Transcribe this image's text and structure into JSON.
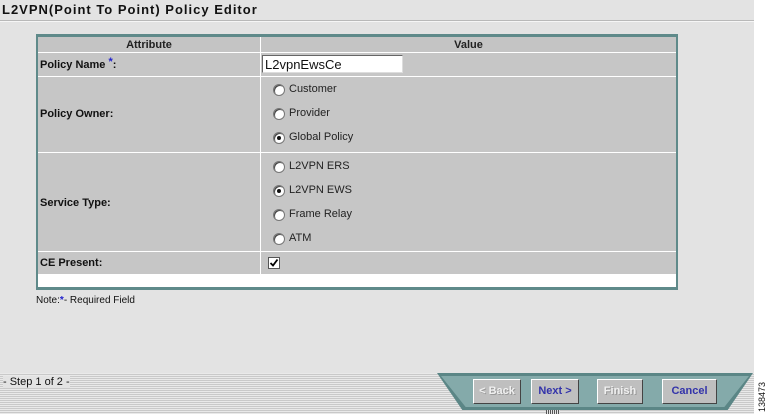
{
  "page": {
    "title": "L2VPN(Point To Point) Policy Editor"
  },
  "table": {
    "header": {
      "attribute": "Attribute",
      "value": "Value"
    },
    "policy_name": {
      "label": "Policy Name",
      "required_mark": "*",
      "colon": ":",
      "value": "L2vpnEwsCe"
    },
    "policy_owner": {
      "label": "Policy Owner:",
      "options": [
        {
          "label": "Customer",
          "selected": false
        },
        {
          "label": "Provider",
          "selected": false
        },
        {
          "label": "Global Policy",
          "selected": true
        }
      ]
    },
    "service_type": {
      "label": "Service Type:",
      "options": [
        {
          "label": "L2VPN ERS",
          "selected": false
        },
        {
          "label": "L2VPN EWS",
          "selected": true
        },
        {
          "label": "Frame Relay",
          "selected": false
        },
        {
          "label": "ATM",
          "selected": false
        }
      ]
    },
    "ce_present": {
      "label": "CE Present:",
      "checked": true
    }
  },
  "note": {
    "prefix": "Note:",
    "star": "*",
    "suffix": "- Required Field"
  },
  "footer": {
    "step": "- Step 1 of 2 -",
    "buttons": {
      "back": "< Back",
      "next": "Next >",
      "finish": "Finish",
      "cancel": "Cancel"
    }
  },
  "figure_id": "138473",
  "colors": {
    "frame": "#5f8a8a",
    "cell": "#c6c6c6",
    "accent_text": "#3333aa",
    "required": "#2222cc"
  }
}
